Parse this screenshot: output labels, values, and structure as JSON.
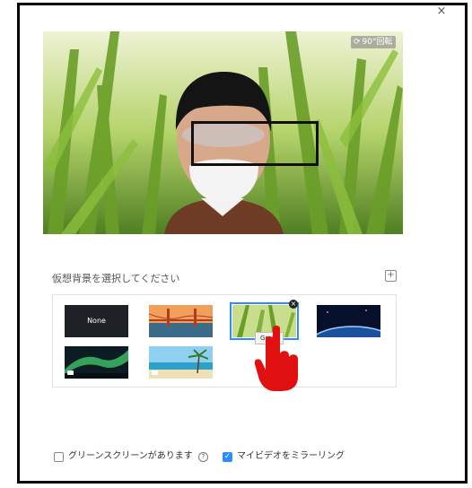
{
  "dialog": {
    "close_glyph": "×"
  },
  "preview": {
    "rotate_label": "90°回転",
    "rotate_icon": "rotate-icon"
  },
  "backgrounds": {
    "title": "仮想背景を選択してください",
    "add_glyph": "+",
    "items": [
      {
        "label": "None",
        "kind": "none"
      },
      {
        "label": "",
        "kind": "bridge"
      },
      {
        "label": "",
        "kind": "grass",
        "selected": true
      },
      {
        "label": "",
        "kind": "earth"
      },
      {
        "label": "",
        "kind": "aurora",
        "video": true
      },
      {
        "label": "",
        "kind": "beach",
        "video": true
      }
    ],
    "selected_tooltip": "Grass",
    "remove_glyph": "×"
  },
  "options": {
    "green_screen_label": "グリーンスクリーンがあります",
    "green_screen_checked": false,
    "help_glyph": "?",
    "mirror_label": "マイビデオをミラーリング",
    "mirror_checked": true,
    "check_glyph": "✓"
  },
  "colors": {
    "accent": "#2d8cff",
    "pointer_hand": "#e01010"
  }
}
